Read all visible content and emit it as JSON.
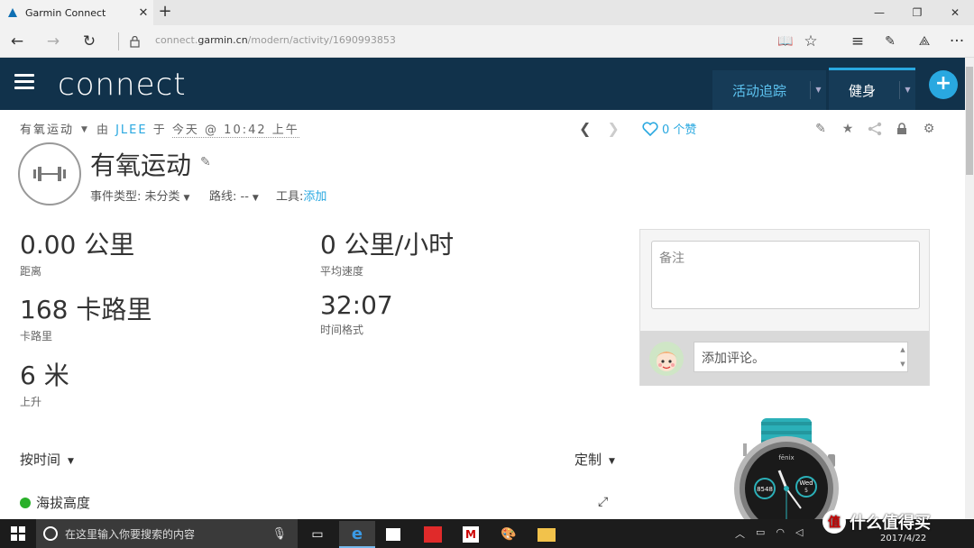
{
  "browser": {
    "tab_title": "Garmin Connect",
    "tab_close": "✕",
    "new_tab": "+",
    "url_prefix": "connect.",
    "url_domain": "garmin.cn",
    "url_path": "/modern/activity/1690993853"
  },
  "header": {
    "logo": "connect",
    "nav": [
      {
        "label": "活动追踪"
      },
      {
        "label": "健身"
      }
    ],
    "add": "+"
  },
  "activity": {
    "type_label": "有氧运动",
    "by": "由",
    "user": "JLEE",
    "at": "于",
    "time": "今天 @ 10:42 上午",
    "likes": "0 个赞",
    "title": "有氧运动",
    "event_type_label": "事件类型:",
    "event_type_value": "未分类",
    "route_label": "路线:",
    "route_value": "--",
    "tools_label": "工具:",
    "tools_link": "添加"
  },
  "stats": [
    {
      "value": "0.00 公里",
      "label": "距离"
    },
    {
      "value": "0 公里/小时",
      "label": "平均速度"
    },
    {
      "value": "168 卡路里",
      "label": "卡路里"
    },
    {
      "value": "32:07",
      "label": "时间格式"
    },
    {
      "value": "6 米",
      "label": "上升"
    }
  ],
  "chart_controls": {
    "sort_by": "按时间",
    "customize": "定制",
    "elevation": "海拔高度"
  },
  "notes": {
    "placeholder": "备注",
    "comment_placeholder": "添加评论。"
  },
  "taskbar": {
    "search_placeholder": "在这里输入你要搜索的内容",
    "date": "2017/4/22",
    "watermark": "什么值得买",
    "watermark_logo": "值"
  },
  "watch": {
    "brand": "fēnix",
    "steps": "8548",
    "day": "Wed",
    "date": "5"
  },
  "colors": {
    "header_bg": "#11324b",
    "accent": "#29a8e0",
    "elevation": "#2ab02a"
  }
}
